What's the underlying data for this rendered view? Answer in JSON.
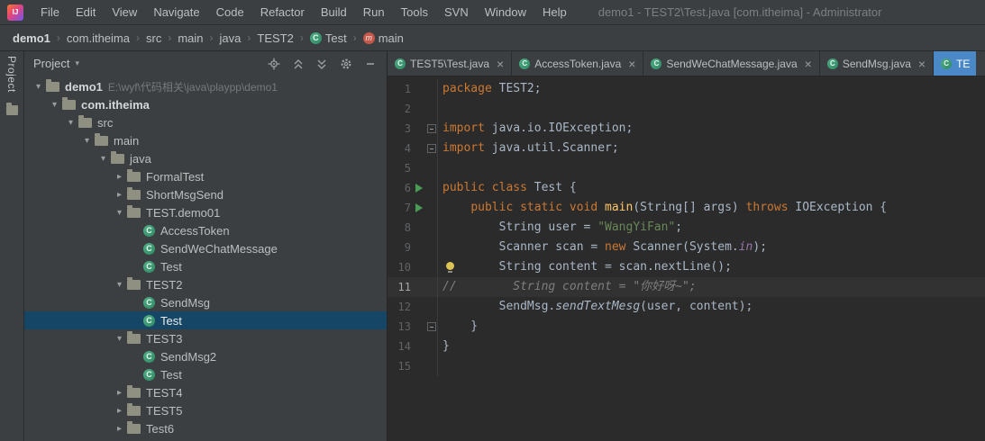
{
  "window": {
    "title": "demo1 - TEST2\\Test.java [com.itheima] - Administrator",
    "logo_text": "IJ"
  },
  "menu_bar": {
    "items": [
      "File",
      "Edit",
      "View",
      "Navigate",
      "Code",
      "Refactor",
      "Build",
      "Run",
      "Tools",
      "SVN",
      "Window",
      "Help"
    ]
  },
  "breadcrumbs": {
    "items": [
      {
        "label": "demo1",
        "bold": true
      },
      {
        "label": "com.itheima"
      },
      {
        "label": "src"
      },
      {
        "label": "main"
      },
      {
        "label": "java"
      },
      {
        "label": "TEST2"
      },
      {
        "label": "Test",
        "icon": "class"
      },
      {
        "label": "main",
        "icon": "method"
      }
    ]
  },
  "tool_strip": {
    "project_tab_label": "Project"
  },
  "project_panel": {
    "title": "Project",
    "tree": [
      {
        "label": "demo1",
        "path": "E:\\wyf\\代码相关\\java\\playpp\\demo1",
        "level": 0,
        "chevron": "open",
        "icon": "folder",
        "bold": true
      },
      {
        "label": "com.itheima",
        "level": 1,
        "chevron": "open",
        "icon": "folder",
        "bold": true
      },
      {
        "label": "src",
        "level": 2,
        "chevron": "open",
        "icon": "folder"
      },
      {
        "label": "main",
        "level": 3,
        "chevron": "open",
        "icon": "folder"
      },
      {
        "label": "java",
        "level": 4,
        "chevron": "open",
        "icon": "folder"
      },
      {
        "label": "FormalTest",
        "level": 5,
        "chevron": "closed",
        "icon": "folder"
      },
      {
        "label": "ShortMsgSend",
        "level": 5,
        "chevron": "closed",
        "icon": "folder"
      },
      {
        "label": "TEST.demo01",
        "level": 5,
        "chevron": "open",
        "icon": "folder"
      },
      {
        "label": "AccessToken",
        "level": 6,
        "icon": "class"
      },
      {
        "label": "SendWeChatMessage",
        "level": 6,
        "icon": "class"
      },
      {
        "label": "Test",
        "level": 6,
        "icon": "class"
      },
      {
        "label": "TEST2",
        "level": 5,
        "chevron": "open",
        "icon": "folder"
      },
      {
        "label": "SendMsg",
        "level": 6,
        "icon": "class"
      },
      {
        "label": "Test",
        "level": 6,
        "icon": "class",
        "selected": true
      },
      {
        "label": "TEST3",
        "level": 5,
        "chevron": "open",
        "icon": "folder"
      },
      {
        "label": "SendMsg2",
        "level": 6,
        "icon": "class"
      },
      {
        "label": "Test",
        "level": 6,
        "icon": "class"
      },
      {
        "label": "TEST4",
        "level": 5,
        "chevron": "closed",
        "icon": "folder"
      },
      {
        "label": "TEST5",
        "level": 5,
        "chevron": "closed",
        "icon": "folder"
      },
      {
        "label": "Test6",
        "level": 5,
        "chevron": "closed",
        "icon": "folder"
      }
    ]
  },
  "editor_tabs": [
    {
      "label": "TEST5\\Test.java",
      "icon": "class",
      "closable": true,
      "active": false
    },
    {
      "label": "AccessToken.java",
      "icon": "class",
      "closable": true,
      "active": false
    },
    {
      "label": "SendWeChatMessage.java",
      "icon": "class",
      "closable": true,
      "active": false
    },
    {
      "label": "SendMsg.java",
      "icon": "class",
      "closable": true,
      "active": false
    },
    {
      "label": "TE",
      "icon": "class",
      "closable": false,
      "active": true,
      "partial": true
    }
  ],
  "editor": {
    "lines": [
      {
        "n": "1",
        "tokens": [
          {
            "s": "kw",
            "t": "package "
          },
          {
            "s": "d",
            "t": "TEST2;"
          }
        ]
      },
      {
        "n": "2",
        "tokens": []
      },
      {
        "n": "3",
        "fold": true,
        "tokens": [
          {
            "s": "kw",
            "t": "import "
          },
          {
            "s": "d",
            "t": "java.io.IOException;"
          }
        ]
      },
      {
        "n": "4",
        "fold": true,
        "tokens": [
          {
            "s": "kw",
            "t": "import "
          },
          {
            "s": "d",
            "t": "java.util.Scanner;"
          }
        ]
      },
      {
        "n": "5",
        "tokens": []
      },
      {
        "n": "6",
        "run": true,
        "tokens": [
          {
            "s": "kw",
            "t": "public class "
          },
          {
            "s": "d",
            "t": "Test {"
          }
        ]
      },
      {
        "n": "7",
        "run": true,
        "tokens": [
          {
            "s": "d",
            "t": "    "
          },
          {
            "s": "kw",
            "t": "public static void "
          },
          {
            "s": "m",
            "t": "main"
          },
          {
            "s": "d",
            "t": "(String[] args) "
          },
          {
            "s": "kw",
            "t": "throws"
          },
          {
            "s": "d",
            "t": " IOException {"
          }
        ]
      },
      {
        "n": "8",
        "tokens": [
          {
            "s": "d",
            "t": "        String user = "
          },
          {
            "s": "str",
            "t": "\"WangYiFan\""
          },
          {
            "s": "d",
            "t": ";"
          }
        ]
      },
      {
        "n": "9",
        "tokens": [
          {
            "s": "d",
            "t": "        Scanner scan = "
          },
          {
            "s": "kw",
            "t": "new"
          },
          {
            "s": "d",
            "t": " Scanner(System."
          },
          {
            "s": "fi",
            "t": "in"
          },
          {
            "s": "d",
            "t": ");"
          }
        ]
      },
      {
        "n": "10",
        "bulb": true,
        "tokens": [
          {
            "s": "d",
            "t": "        String content = scan.nextLine();"
          }
        ]
      },
      {
        "n": "11",
        "current": true,
        "tokens": [
          {
            "s": "com",
            "t": "//        String content = \"你好呀~\";"
          }
        ]
      },
      {
        "n": "12",
        "tokens": [
          {
            "s": "d",
            "t": "        SendMsg."
          },
          {
            "s": "sm",
            "t": "sendTextMesg"
          },
          {
            "s": "d",
            "t": "(user, content);"
          }
        ]
      },
      {
        "n": "13",
        "fold": true,
        "tokens": [
          {
            "s": "d",
            "t": "    }"
          }
        ]
      },
      {
        "n": "14",
        "tokens": [
          {
            "s": "d",
            "t": "}"
          }
        ]
      },
      {
        "n": "15",
        "tokens": []
      }
    ]
  },
  "colors": {
    "editor_background": "#2b2b2b",
    "panel_background": "#3c3f41",
    "active_tab": "#4a88c7",
    "tree_selection": "#164665",
    "keyword": "#cc7832",
    "string": "#6a8759",
    "comment": "#7f7f7f",
    "method": "#ffc66b",
    "static_field": "#9876aa",
    "run_arrow": "#499c54",
    "class_icon": "#3f9e78",
    "method_icon": "#c5584b"
  }
}
